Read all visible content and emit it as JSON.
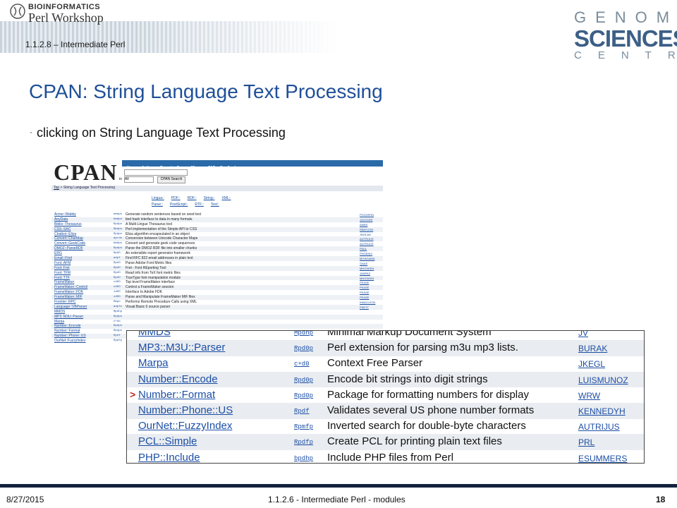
{
  "header": {
    "logo_top": "BIOINFORMATICS",
    "logo_bottom": "Perl Workshop",
    "course": "1.1.2.8 – Intermediate Perl",
    "gsc_row1": "GENOME",
    "gsc_row2": "SCIENCES",
    "gsc_row3": "CENTRE"
  },
  "slide": {
    "title": "CPAN: String Language Text Processing",
    "bullet": "clicking on String Language Text Processing"
  },
  "cpan": {
    "logo": "CPAN",
    "nav": [
      "Home",
      "Authors",
      "Recent",
      "News",
      "Mirrors",
      "FAQ",
      "Feedback"
    ],
    "select_value": "All",
    "search_button": "CPAN Search",
    "in_label": "in",
    "breadcrumb_top": "Top",
    "breadcrumb_rest": " > String Language Text Processing",
    "cats_row1": [
      "Lingua::",
      "PDF::",
      "RDF::",
      "String::",
      "XML::"
    ],
    "cats_row2": [
      "Parse::",
      "PostScript::",
      "RTF::",
      "Text::"
    ],
    "rows": [
      {
        "module": "Acme::Wabby",
        "dsli": "bmdpo",
        "desc": "Generate random sentences based on seed text",
        "author": "PGOVERN"
      },
      {
        "module": "AnyData",
        "dsli": "bmdpo",
        "desc": "tied hash interface to data in many formats",
        "author": "JZUCKER"
      },
      {
        "module": "Biblio::Thesaurus",
        "dsli": "Rpdpo",
        "desc": "A Multi-Lingue Thesaurus tool",
        "author": "AMBS"
      },
      {
        "module": "CSS::SAC",
        "dsli": "Rpdpo",
        "desc": "Perl implementation of the Simple API to CSS",
        "author": "RBERJON"
      },
      {
        "module": "Chatbot::Eliza",
        "dsli": "Rpdpo",
        "desc": "Eliza algorithm encapsulated in an object",
        "author": "JNOLAN"
      },
      {
        "module": "Convert::CharMap",
        "dsli": "aprdo",
        "desc": "Conversion between Unicode Character Maps",
        "author": "AUTRIJUS"
      },
      {
        "module": "Convert::GeekCode",
        "dsli": "bmdpo",
        "desc": "Convert and generate geek code sequences",
        "author": "AUTRIJUS"
      },
      {
        "module": "DMOZ::ParseRDF",
        "dsli": "Rpdpo",
        "desc": "Parse the DMOZ RDF file into smaller chunks",
        "author": "PAUL"
      },
      {
        "module": "ERG",
        "dsli": "RpdO",
        "desc": "An extensible report generator framework",
        "author": "PHOENIX"
      },
      {
        "module": "Email::Find",
        "dsli": "adpf",
        "desc": "Find RFC 822 email addresses in plain text",
        "author": "MIYAGAWA"
      },
      {
        "module": "Font::AFM",
        "dsli": "RpdO",
        "desc": "Parse Adobe Font Metric files",
        "author": "GAAS"
      },
      {
        "module": "Font::Fret",
        "dsli": "RpdO",
        "desc": "Fret - Font REporting Tool",
        "author": "MHOSKEN"
      },
      {
        "module": "Font::TFM",
        "dsli": "RpdO",
        "desc": "Read info from TeX font metric files",
        "author": "JANPAZ"
      },
      {
        "module": "Font::TTF",
        "dsli": "RpdO",
        "desc": "TrueType font manipulation module",
        "author": "MHOSKEN"
      },
      {
        "module": "FrameMaker",
        "dsli": "cdOO",
        "desc": "Top level FrameMaker interface",
        "author": "PEASE"
      },
      {
        "module": "FrameMaker::Control",
        "dsli": "cdOO",
        "desc": "Control a FrameMaker session",
        "author": "PEASE"
      },
      {
        "module": "FrameMaker::FDK",
        "dsli": "idOO",
        "desc": "Interface to Adobe FDK",
        "author": "PEASE"
      },
      {
        "module": "FrameMaker::MIF",
        "dsli": "cdOO",
        "desc": "Parse and Manipulate FrameMaker MIF files",
        "author": "PEASE"
      },
      {
        "module": "Frontier::RPC",
        "dsli": "Rmpo",
        "desc": "Performs Remote Procedure Calls using XML",
        "author": "KMACLEOD"
      },
      {
        "module": "Language::VBParser",
        "dsli": "adpfo",
        "desc": "Visual Basic 6 source parser",
        "author": "FRETT"
      },
      {
        "module": "MMDS",
        "dsli": "Mpdhp",
        "desc": "",
        "author": ""
      },
      {
        "module": "MP3::M3U::Parser",
        "dsli": "Rpdpo",
        "desc": "",
        "author": ""
      },
      {
        "module": "Marpa",
        "dsli": "c+do",
        "desc": "",
        "author": ""
      },
      {
        "module": "Number::Encode",
        "dsli": "Rpdpo",
        "desc": "",
        "author": ""
      },
      {
        "module": "Number::Format",
        "dsli": "Rpdpo",
        "desc": "",
        "author": ""
      },
      {
        "module": "Number::Phone::US",
        "dsli": "Rpdf",
        "desc": "",
        "author": ""
      },
      {
        "module": "OurNet::FuzzyIndex",
        "dsli": "Rpmfp",
        "desc": "",
        "author": ""
      }
    ]
  },
  "zoom": {
    "rows": [
      {
        "module": "MMDS",
        "dsli": "Mpdhp",
        "desc": "Minimal Markup Document System",
        "author": "JV"
      },
      {
        "module": "MP3::M3U::Parser",
        "dsli": "Rpd0p",
        "desc": "Perl extension for parsing m3u mp3 lists.",
        "author": "BURAK"
      },
      {
        "module": "Marpa",
        "dsli": "c+d0",
        "desc": "Context Free Parser",
        "author": "JKEGL"
      },
      {
        "module": "Number::Encode",
        "dsli": "Rpd0p",
        "desc": "Encode bit strings into digit strings",
        "author": "LUISMUNOZ"
      },
      {
        "module": "Number::Format",
        "dsli": "Rpd0p",
        "desc": "Package for formatting numbers for display",
        "author": "WRW",
        "marker": ">"
      },
      {
        "module": "Number::Phone::US",
        "dsli": "Rpdf",
        "desc": "Validates several US phone number formats",
        "author": "KENNEDYH"
      },
      {
        "module": "OurNet::FuzzyIndex",
        "dsli": "Rpmfp",
        "desc": "Inverted search for double-byte characters",
        "author": "AUTRIJUS"
      },
      {
        "module": "PCL::Simple",
        "dsli": "Rpdfp",
        "desc": "Create PCL for printing plain text files",
        "author": "PRL"
      },
      {
        "module": "PHP::Include",
        "dsli": "bpdhp",
        "desc": "Include PHP files from Perl",
        "author": "ESUMMERS"
      }
    ]
  },
  "footer": {
    "date": "8/27/2015",
    "middle": "1.1.2.6 - Intermediate Perl - modules",
    "page": "18"
  },
  "colors": {
    "title": "#1f4f98",
    "link": "#1c4fa6",
    "arrow": "#c1272d",
    "footer_bar": "#14213d"
  }
}
